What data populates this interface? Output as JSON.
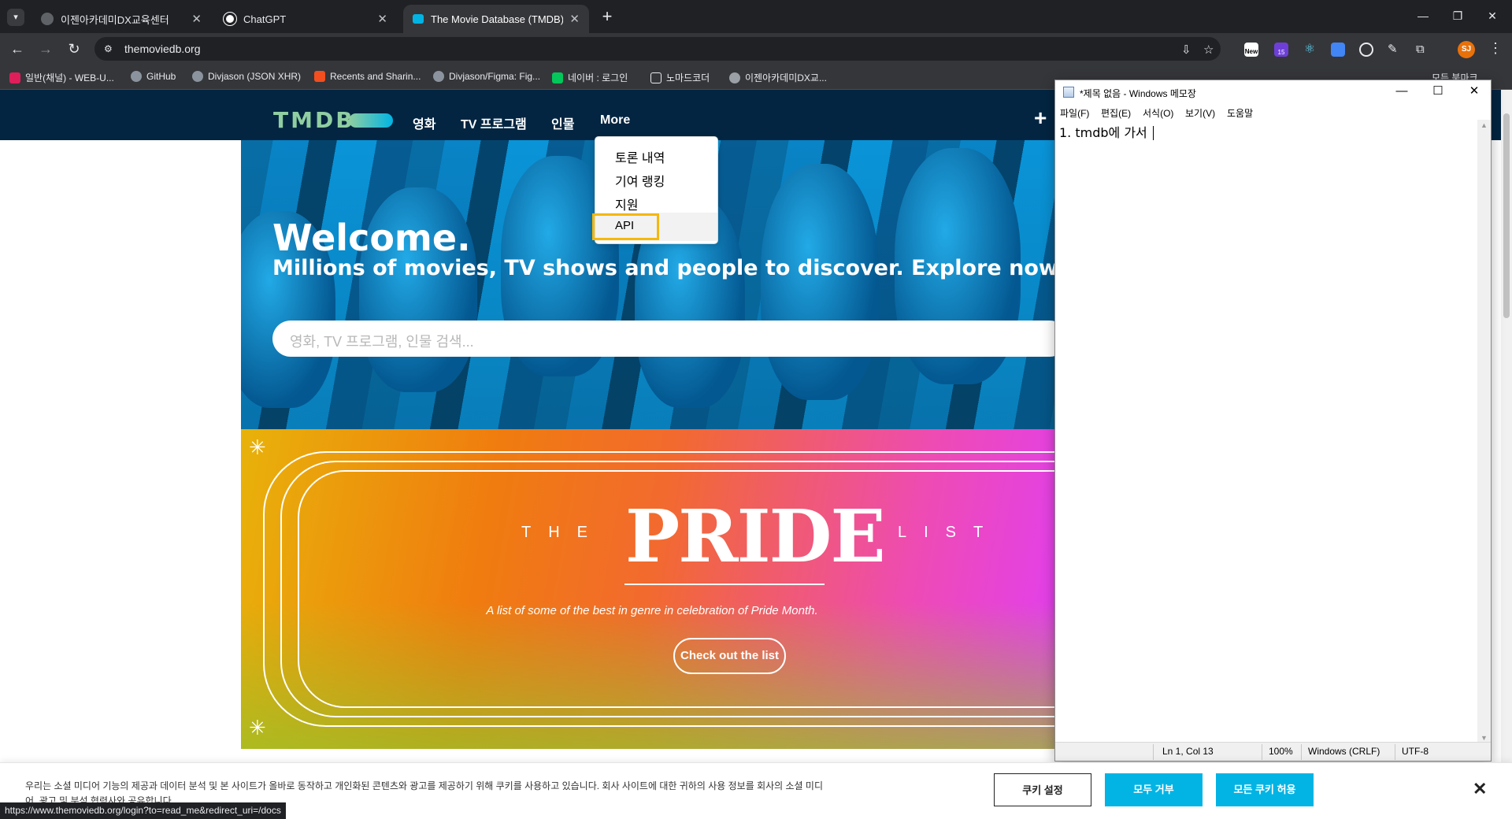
{
  "browser": {
    "tabs": [
      {
        "title": "이젠아카데미DX교육센터",
        "active": false
      },
      {
        "title": "ChatGPT",
        "active": false
      },
      {
        "title": "The Movie Database (TMDB)",
        "active": true
      }
    ],
    "url": "themoviedb.org",
    "bookmarks": [
      "일반(채널) - WEB-U...",
      "GitHub",
      "Divjason (JSON XHR)",
      "Recents and Sharin...",
      "Divjason/Figma: Fig...",
      "네이버 : 로그인",
      "노마드코더",
      "이젠아카데미DX교..."
    ],
    "bookmarks_right": "모든 북마크",
    "ext_badge_new": "New",
    "ext_badge_count": "15",
    "profile_initials": "SJ",
    "status_url": "https://www.themoviedb.org/login?to=read_me&redirect_uri=/docs"
  },
  "tmdb": {
    "logo": "TMDB",
    "nav": [
      "영화",
      "TV 프로그램",
      "인물",
      "More"
    ],
    "more_menu": [
      "토론 내역",
      "기여 랭킹",
      "지원",
      "API"
    ],
    "hero_title": "Welcome.",
    "hero_subtitle": "Millions of movies, TV shows and people to discover. Explore now.",
    "search_placeholder": "영화, TV 프로그램, 인물 검색...",
    "pride": {
      "the": "THE",
      "title": "PRIDE",
      "list": "LIST",
      "caption": "A list of some of the best in genre in celebration of Pride Month.",
      "button": "Check out the list"
    },
    "cookie": {
      "text": "우리는 소셜 미디어 기능의 제공과 데이터 분석 및 본 사이트가 올바로 동작하고 개인화된 콘텐츠와 광고를 제공하기 위해 쿠키를 사용하고 있습니다. 회사 사이트에 대한 귀하의 사용 정보를 회사의 소셜 미디어, 광고 및 분석 협력사와 공유합니다.",
      "settings": "쿠키 설정",
      "reject": "모두 거부",
      "accept": "모든 쿠키 허용"
    }
  },
  "notepad": {
    "title": "*제목 없음 - Windows 메모장",
    "menu": [
      "파일(F)",
      "편집(E)",
      "서식(O)",
      "보기(V)",
      "도움말"
    ],
    "content": "1. tmdb에 가서 ",
    "status": {
      "position": "Ln 1, Col 13",
      "zoom": "100%",
      "eol": "Windows (CRLF)",
      "encoding": "UTF-8"
    }
  },
  "colors": {
    "tmdb_navy": "#032541",
    "tmdb_green": "#90cea1",
    "tmdb_blue": "#01b4e4",
    "highlight": "#f5b80c"
  }
}
